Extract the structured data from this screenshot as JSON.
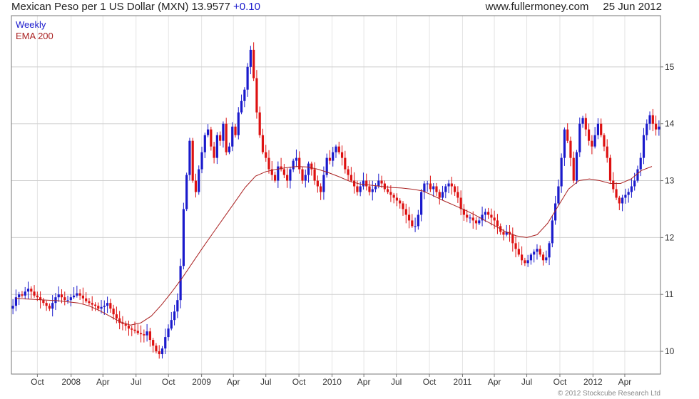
{
  "header": {
    "title": "Mexican Peso per 1 US Dollar (MXN)",
    "last": "13.9577",
    "change": "+0.10",
    "site": "www.fullermoney.com",
    "date": "25 Jun 2012"
  },
  "footer": {
    "copyright": "© 2012 Stockcube Research Ltd"
  },
  "chart_data": {
    "type": "candlestick",
    "legend": [
      {
        "name": "Weekly",
        "color": "#1a1acc"
      },
      {
        "name": "EMA 200",
        "color": "#aa2222"
      }
    ],
    "legend_placement": "top-left",
    "grid": true,
    "ylim": [
      9.6,
      15.9
    ],
    "yticks": [
      10,
      11,
      12,
      13,
      14,
      15
    ],
    "xticks": [
      {
        "label": "Oct",
        "pos": 0.04
      },
      {
        "label": "2008",
        "pos": 0.092
      },
      {
        "label": "Apr",
        "pos": 0.141
      },
      {
        "label": "Jul",
        "pos": 0.192
      },
      {
        "label": "Oct",
        "pos": 0.242
      },
      {
        "label": "2009",
        "pos": 0.293
      },
      {
        "label": "Apr",
        "pos": 0.342
      },
      {
        "label": "Jul",
        "pos": 0.392
      },
      {
        "label": "Oct",
        "pos": 0.443
      },
      {
        "label": "2010",
        "pos": 0.494
      },
      {
        "label": "Apr",
        "pos": 0.543
      },
      {
        "label": "Jul",
        "pos": 0.593
      },
      {
        "label": "Oct",
        "pos": 0.644
      },
      {
        "label": "2011",
        "pos": 0.695
      },
      {
        "label": "Apr",
        "pos": 0.744
      },
      {
        "label": "Jul",
        "pos": 0.794
      },
      {
        "label": "Oct",
        "pos": 0.845
      },
      {
        "label": "2012",
        "pos": 0.896
      },
      {
        "label": "Apr",
        "pos": 0.945
      }
    ],
    "series": [
      {
        "name": "Weekly",
        "type": "candlestick",
        "up_color": "#1a1acc",
        "down_color": "#dd1111",
        "closes": [
          10.8,
          10.95,
          11.0,
          10.98,
          11.05,
          11.1,
          11.05,
          10.98,
          10.95,
          10.9,
          10.85,
          10.8,
          10.75,
          10.85,
          10.95,
          11.0,
          10.95,
          10.9,
          10.9,
          10.95,
          10.98,
          11.02,
          10.98,
          10.93,
          10.88,
          10.85,
          10.82,
          10.8,
          10.75,
          10.78,
          10.8,
          10.85,
          10.75,
          10.65,
          10.58,
          10.5,
          10.48,
          10.45,
          10.4,
          10.38,
          10.36,
          10.32,
          10.3,
          10.28,
          10.35,
          10.2,
          10.1,
          10.0,
          9.95,
          10.05,
          10.25,
          10.4,
          10.55,
          10.7,
          10.9,
          11.5,
          12.5,
          13.1,
          13.7,
          13.0,
          12.8,
          13.2,
          13.5,
          13.8,
          13.9,
          13.6,
          13.4,
          13.8,
          13.7,
          14.0,
          13.5,
          13.6,
          13.95,
          13.8,
          14.2,
          14.4,
          14.6,
          15.0,
          15.3,
          14.8,
          14.2,
          13.8,
          13.5,
          13.4,
          13.2,
          13.1,
          13.0,
          13.25,
          13.2,
          13.1,
          13.0,
          13.2,
          13.35,
          13.4,
          13.2,
          13.0,
          13.1,
          13.3,
          13.2,
          13.0,
          12.9,
          12.8,
          13.1,
          13.4,
          13.35,
          13.5,
          13.6,
          13.5,
          13.4,
          13.2,
          13.1,
          13.0,
          12.9,
          12.8,
          12.9,
          13.0,
          12.9,
          12.8,
          12.85,
          12.9,
          13.0,
          12.95,
          12.85,
          12.8,
          12.75,
          12.7,
          12.65,
          12.6,
          12.5,
          12.4,
          12.3,
          12.2,
          12.2,
          12.4,
          12.8,
          12.95,
          12.95,
          12.85,
          12.9,
          12.8,
          12.7,
          12.8,
          12.9,
          12.95,
          12.9,
          12.8,
          12.7,
          12.5,
          12.4,
          12.35,
          12.35,
          12.3,
          12.25,
          12.3,
          12.4,
          12.45,
          12.4,
          12.35,
          12.3,
          12.2,
          12.1,
          12.05,
          12.1,
          12.05,
          11.9,
          11.8,
          11.7,
          11.6,
          11.55,
          11.6,
          11.7,
          11.75,
          11.8,
          11.7,
          11.6,
          11.65,
          11.9,
          12.3,
          12.6,
          12.9,
          13.4,
          13.9,
          13.7,
          13.4,
          13.0,
          13.5,
          14.0,
          14.1,
          13.9,
          13.7,
          13.6,
          13.8,
          14.0,
          13.8,
          13.6,
          13.4,
          13.0,
          12.85,
          12.7,
          12.6,
          12.7,
          12.75,
          12.8,
          12.9,
          13.0,
          13.2,
          13.4,
          13.8,
          14.0,
          14.15,
          14.0,
          13.9,
          13.95
        ]
      },
      {
        "name": "EMA 200",
        "type": "line",
        "color": "#aa2222",
        "values": [
          10.93,
          10.92,
          10.91,
          10.9,
          10.89,
          10.87,
          10.85,
          10.8,
          10.72,
          10.62,
          10.52,
          10.46,
          10.5,
          10.62,
          10.82,
          11.05,
          11.3,
          11.57,
          11.84,
          12.1,
          12.36,
          12.62,
          12.88,
          13.08,
          13.16,
          13.2,
          13.23,
          13.25,
          13.24,
          13.2,
          13.14,
          13.07,
          12.99,
          12.94,
          12.92,
          12.9,
          12.88,
          12.87,
          12.85,
          12.82,
          12.74,
          12.65,
          12.57,
          12.49,
          12.4,
          12.3,
          12.2,
          12.1,
          12.03,
          12.0,
          12.05,
          12.25,
          12.55,
          12.85,
          13.0,
          13.03,
          13.0,
          12.95,
          12.95,
          13.03,
          13.18,
          13.25
        ]
      }
    ]
  }
}
